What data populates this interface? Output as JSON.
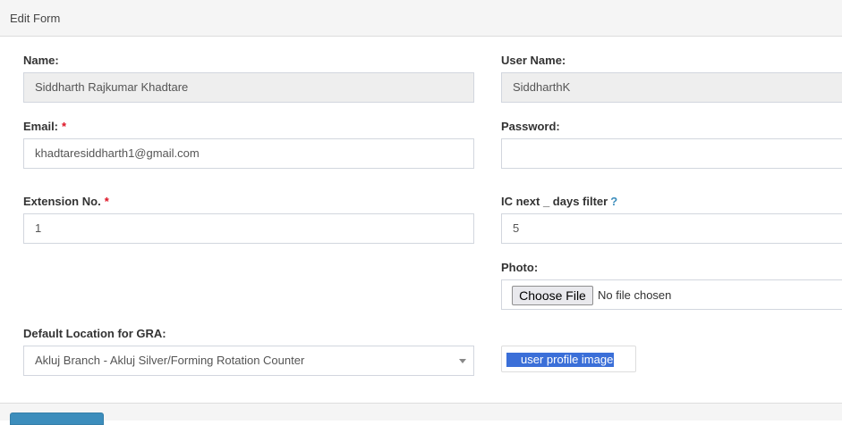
{
  "header": {
    "title": "Edit Form"
  },
  "fields": {
    "name": {
      "label": "Name:",
      "value": "Siddharth Rajkumar Khadtare"
    },
    "username": {
      "label": "User Name:",
      "value": "SiddharthK"
    },
    "email": {
      "label": "Email:",
      "required_mark": "*",
      "value": "khadtaresiddharth1@gmail.com"
    },
    "password": {
      "label": "Password:",
      "value": ""
    },
    "extension": {
      "label": "Extension No.",
      "required_mark": "*",
      "value": "1"
    },
    "ic_filter": {
      "label": "IC next _ days filter",
      "help_mark": "?",
      "value": "5"
    },
    "photo": {
      "label": "Photo:",
      "button_label": "Choose File",
      "status": "No file chosen",
      "image_alt": "user profile image"
    },
    "location": {
      "label": "Default Location for GRA:",
      "value": "Akluj Branch - Akluj Silver/Forming Rotation Counter"
    }
  },
  "colors": {
    "accent": "#3c8dbc",
    "required": "#dd1122",
    "readonly_bg": "#eeeeee"
  }
}
